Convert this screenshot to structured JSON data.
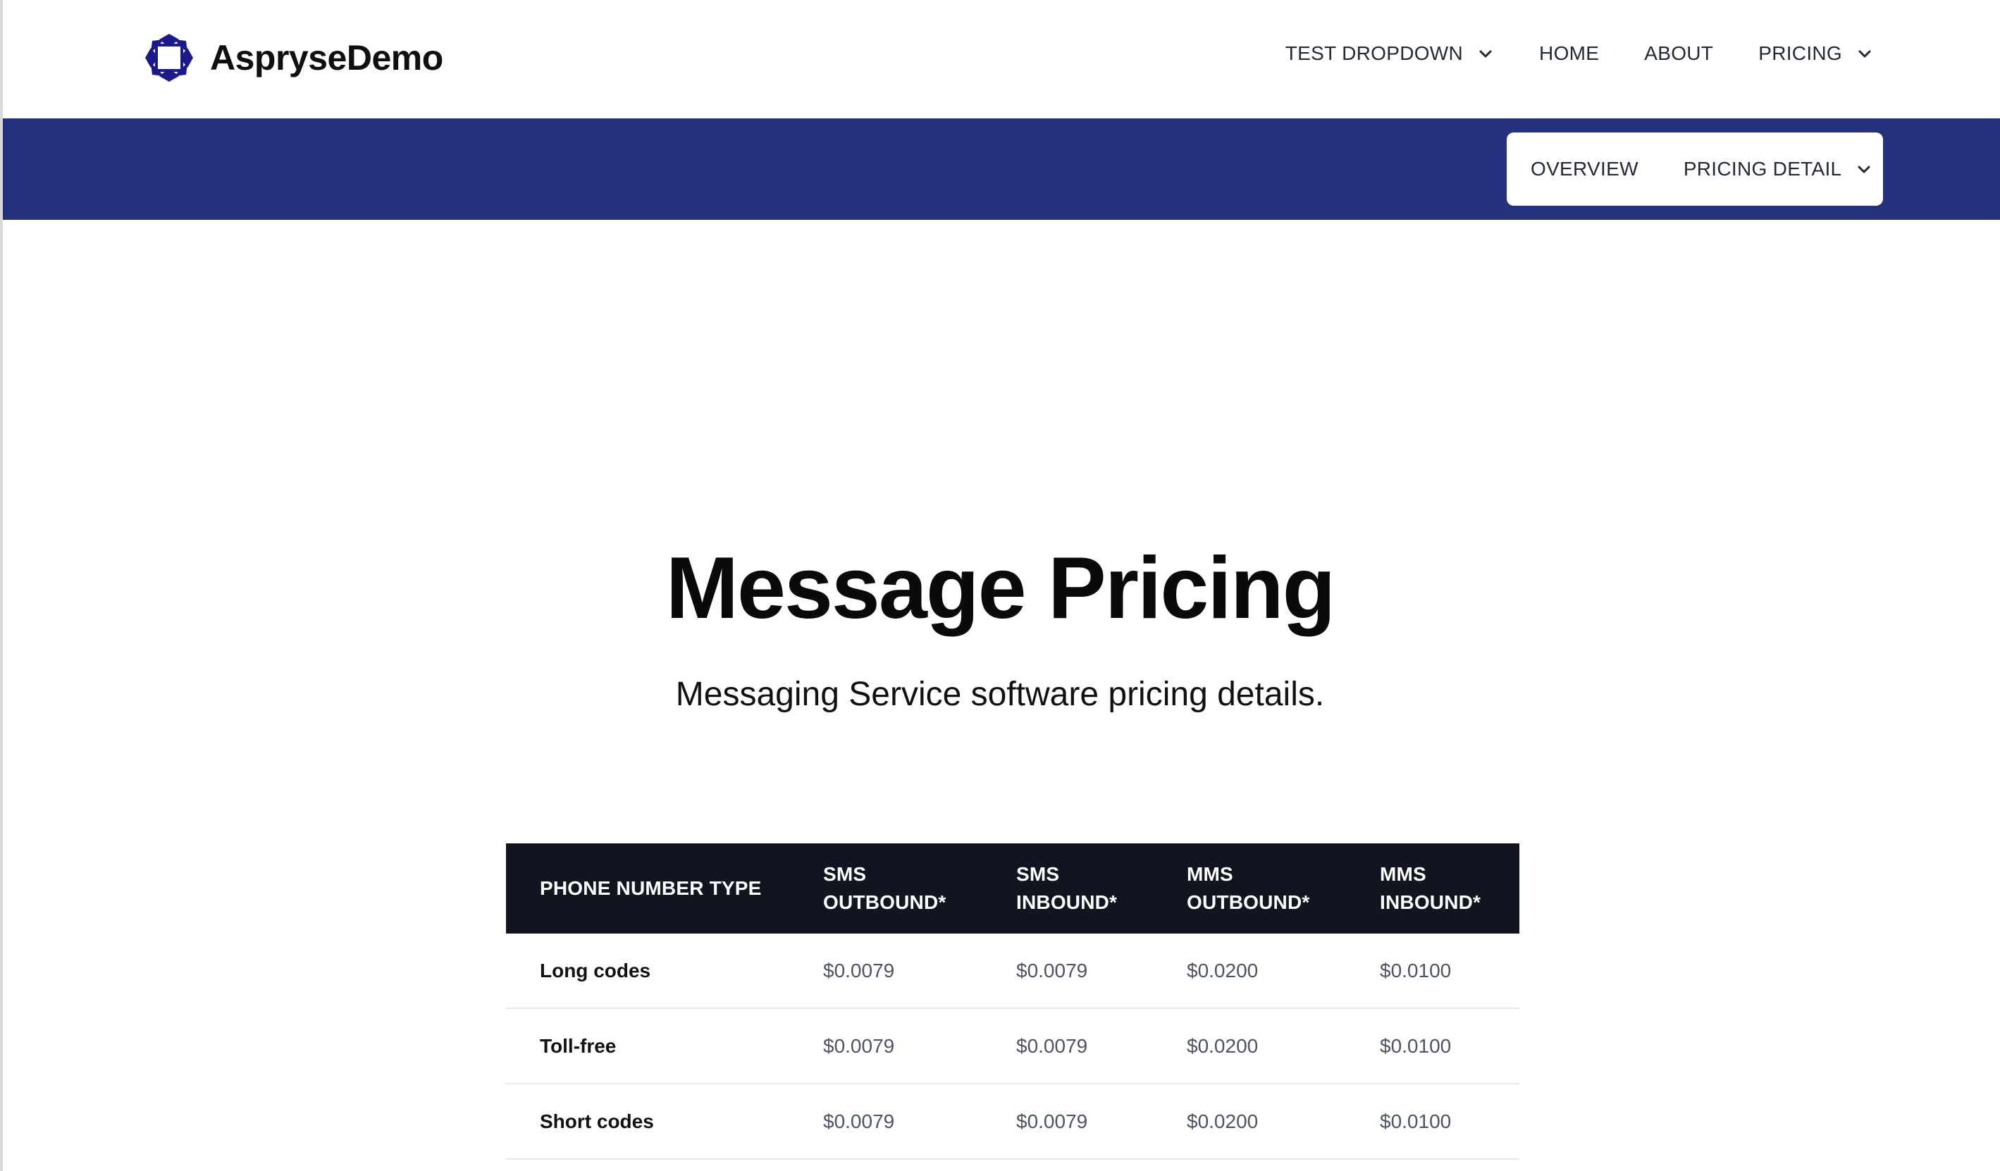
{
  "colors": {
    "brand_band": "#25317d",
    "table_header_bg": "#11151f",
    "logo": "#1a1a8c",
    "text_dark": "#0a0a0a",
    "text_muted": "#4b5563"
  },
  "brand": {
    "name": "AspryseDemo",
    "logo_icon": "octagon-logo-icon"
  },
  "nav": {
    "items": [
      {
        "label": "TEST DROPDOWN",
        "has_dropdown": true
      },
      {
        "label": "HOME",
        "has_dropdown": false
      },
      {
        "label": "ABOUT",
        "has_dropdown": false
      },
      {
        "label": "PRICING",
        "has_dropdown": true
      }
    ]
  },
  "subnav": {
    "items": [
      {
        "label": "OVERVIEW",
        "has_dropdown": false
      },
      {
        "label": "PRICING DETAIL",
        "has_dropdown": true
      }
    ]
  },
  "hero": {
    "title": "Message Pricing",
    "subtitle": "Messaging Service software pricing details."
  },
  "table": {
    "headers": [
      [
        "PHONE NUMBER TYPE"
      ],
      [
        "SMS",
        "OUTBOUND*"
      ],
      [
        "SMS",
        "INBOUND*"
      ],
      [
        "MMS",
        "OUTBOUND*"
      ],
      [
        "MMS",
        "INBOUND*"
      ]
    ],
    "rows": [
      [
        "Long codes",
        "$0.0079",
        "$0.0079",
        "$0.0200",
        "$0.0100"
      ],
      [
        "Toll-free",
        "$0.0079",
        "$0.0079",
        "$0.0200",
        "$0.0100"
      ],
      [
        "Short codes",
        "$0.0079",
        "$0.0079",
        "$0.0200",
        "$0.0100"
      ]
    ]
  }
}
